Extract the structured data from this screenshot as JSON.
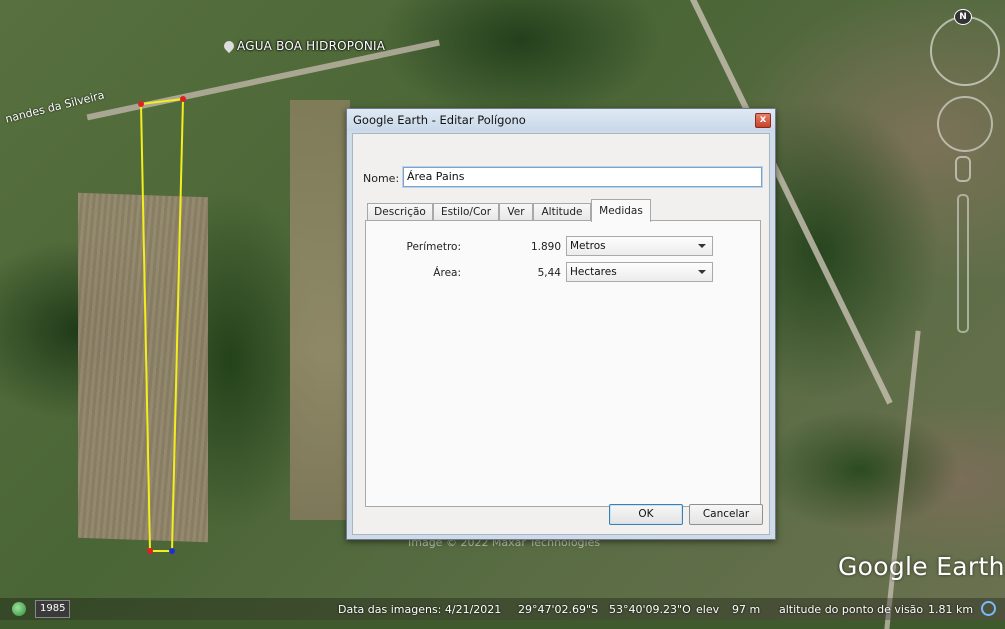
{
  "map": {
    "poi_label": "AGUA BOA HIDROPONIA",
    "road_label": "nandes da Silveira",
    "imagery_credit": "Image © 2022 Maxar Technologies",
    "logo": "Google Earth",
    "compass_letter": "N"
  },
  "statusbar": {
    "year": "1985",
    "image_date": "Data das imagens: 4/21/2021",
    "lat": "29°47'02.69\"S",
    "lon": "53°40'09.23\"O",
    "elev_label": "elev",
    "elev_value": "97 m",
    "view_alt": "altitude do ponto de visão",
    "view_alt_value": "1.81 km"
  },
  "dialog": {
    "title": "Google Earth - Editar Polígono",
    "close_glyph": "x",
    "name_label": "Nome:",
    "name_value": "Área Pains",
    "tabs": [
      {
        "label": "Descrição",
        "active": false
      },
      {
        "label": "Estilo/Cor",
        "active": false
      },
      {
        "label": "Ver",
        "active": false
      },
      {
        "label": "Altitude",
        "active": false
      },
      {
        "label": "Medidas",
        "active": true
      }
    ],
    "measurements": {
      "perimeter_label": "Perímetro:",
      "perimeter_value": "1.890",
      "perimeter_unit": "Metros",
      "area_label": "Área:",
      "area_value": "5,44",
      "area_unit": "Hectares"
    },
    "ok_label": "OK",
    "cancel_label": "Cancelar"
  }
}
